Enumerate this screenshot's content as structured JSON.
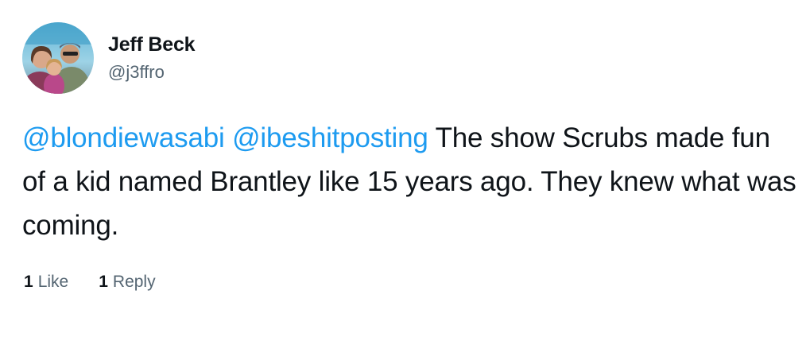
{
  "user": {
    "display_name": "Jeff Beck",
    "handle": "@j3ffro"
  },
  "tweet": {
    "mention_1": "@blondiewasabi",
    "mention_2": "@ibeshitposting",
    "text": "The show Scrubs made fun of a kid named Brantley like 15 years ago. They knew what was coming."
  },
  "stats": {
    "likes_count": "1",
    "likes_label": "Like",
    "replies_count": "1",
    "replies_label": "Reply"
  },
  "colors": {
    "mention": "#1d9bf0",
    "text": "#0f1419",
    "secondary": "#536471"
  }
}
